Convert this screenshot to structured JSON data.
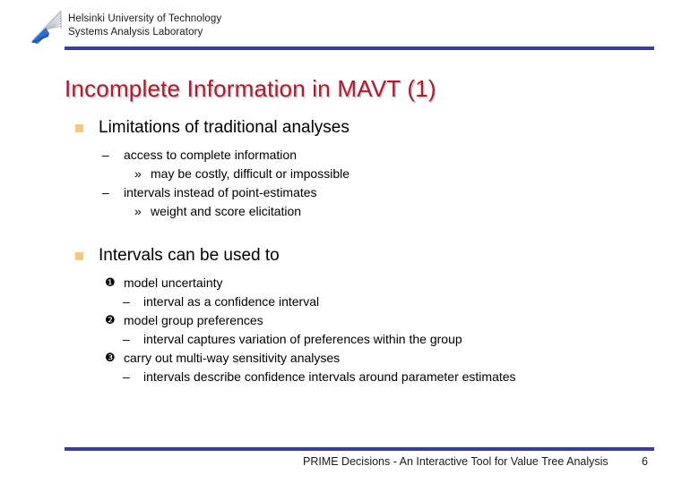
{
  "slide": {
    "header": {
      "logo_name": "hut-fan-logo",
      "line1": "Helsinki University of Technology",
      "line2": "Systems Analysis Laboratory"
    },
    "title": "Incomplete Information in MAVT (1)",
    "sections": [
      {
        "bullet_glyph": "■",
        "heading": "Limitations of traditional analyses",
        "items": [
          {
            "level": 2,
            "glyph": "–",
            "text": "access to complete information"
          },
          {
            "level": 3,
            "glyph": "»",
            "text": "may be costly, difficult or impossible"
          },
          {
            "level": 2,
            "glyph": "–",
            "text": "intervals instead of point-estimates"
          },
          {
            "level": 3,
            "glyph": "»",
            "text": "weight and score elicitation"
          }
        ]
      },
      {
        "bullet_glyph": "■",
        "heading": "Intervals can be used to",
        "items": [
          {
            "level": "num",
            "glyph": "❶",
            "text": "model uncertainty"
          },
          {
            "level": "num-sub",
            "glyph": "–",
            "text": "interval as a confidence interval"
          },
          {
            "level": "num",
            "glyph": "❷",
            "text": "model group preferences"
          },
          {
            "level": "num-sub",
            "glyph": "–",
            "text": "interval captures variation of preferences within the group"
          },
          {
            "level": "num",
            "glyph": "❸",
            "text": "carry out multi-way sensitivity analyses"
          },
          {
            "level": "num-sub",
            "glyph": "–",
            "text": "intervals describe confidence intervals around parameter estimates"
          }
        ]
      }
    ],
    "footer": {
      "text": "PRIME Decisions - An Interactive Tool for Value Tree Analysis",
      "page_number": "6"
    },
    "colors": {
      "rule": "#3b3f8f",
      "title": "#9e2235",
      "bullet_square": "#f6c97e",
      "background": "#ffffff"
    }
  }
}
